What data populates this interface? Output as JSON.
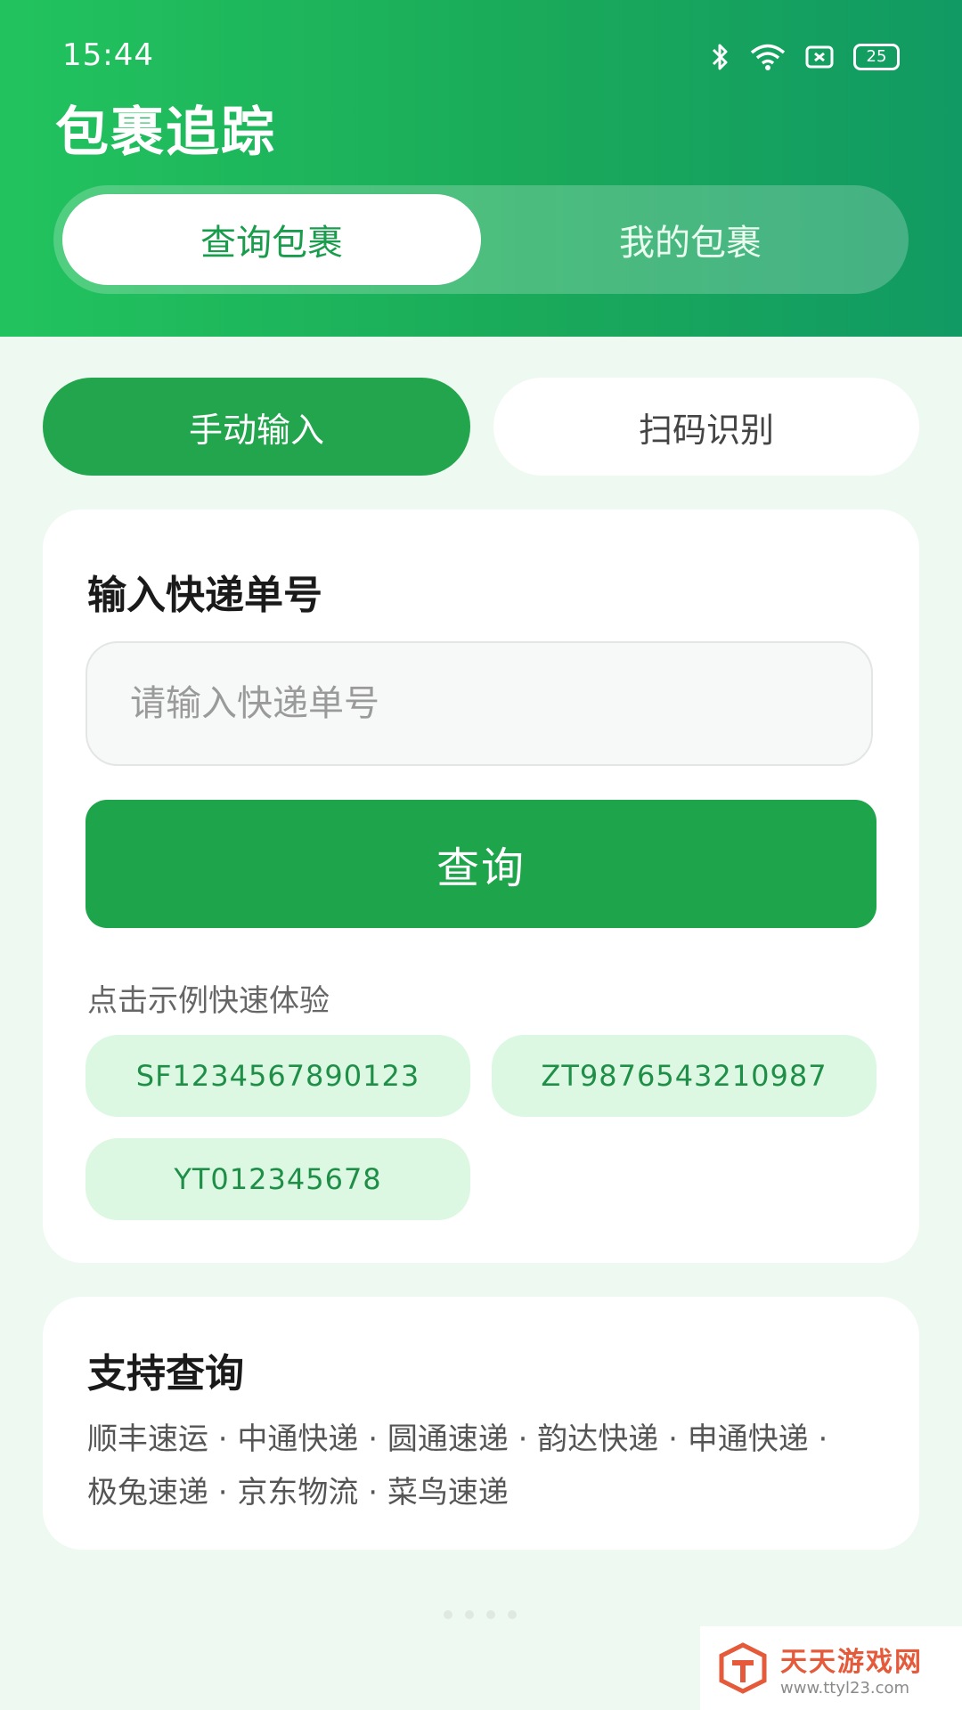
{
  "status": {
    "time": "15:44",
    "battery": "25",
    "icons": [
      "bluetooth-icon",
      "wifi-icon",
      "sim-icon",
      "battery-icon"
    ]
  },
  "header": {
    "title": "包裹追踪",
    "tabs": [
      "查询包裹",
      "我的包裹"
    ]
  },
  "mode_tabs": [
    "手动输入",
    "扫码识别"
  ],
  "query_card": {
    "title": "输入快递单号",
    "placeholder": "请输入快递单号",
    "button": "查询",
    "hint": "点击示例快速体验",
    "examples": [
      "SF1234567890123",
      "ZT9876543210987",
      "YT012345678"
    ]
  },
  "support_card": {
    "title": "支持查询",
    "line1": "顺丰速运 · 中通快递 · 圆通速递 · 韵达快递 · 申通快递 ·",
    "line2": "极兔速递 · 京东物流 · 菜鸟速递"
  },
  "watermark": {
    "name": "天天游戏网",
    "url": "www.ttyl23.com"
  },
  "colors": {
    "primary": "#1ea44b",
    "header_start": "#22c35e",
    "header_end": "#119a63",
    "chip_bg": "#dcf8e3",
    "chip_text": "#1f8f48"
  }
}
